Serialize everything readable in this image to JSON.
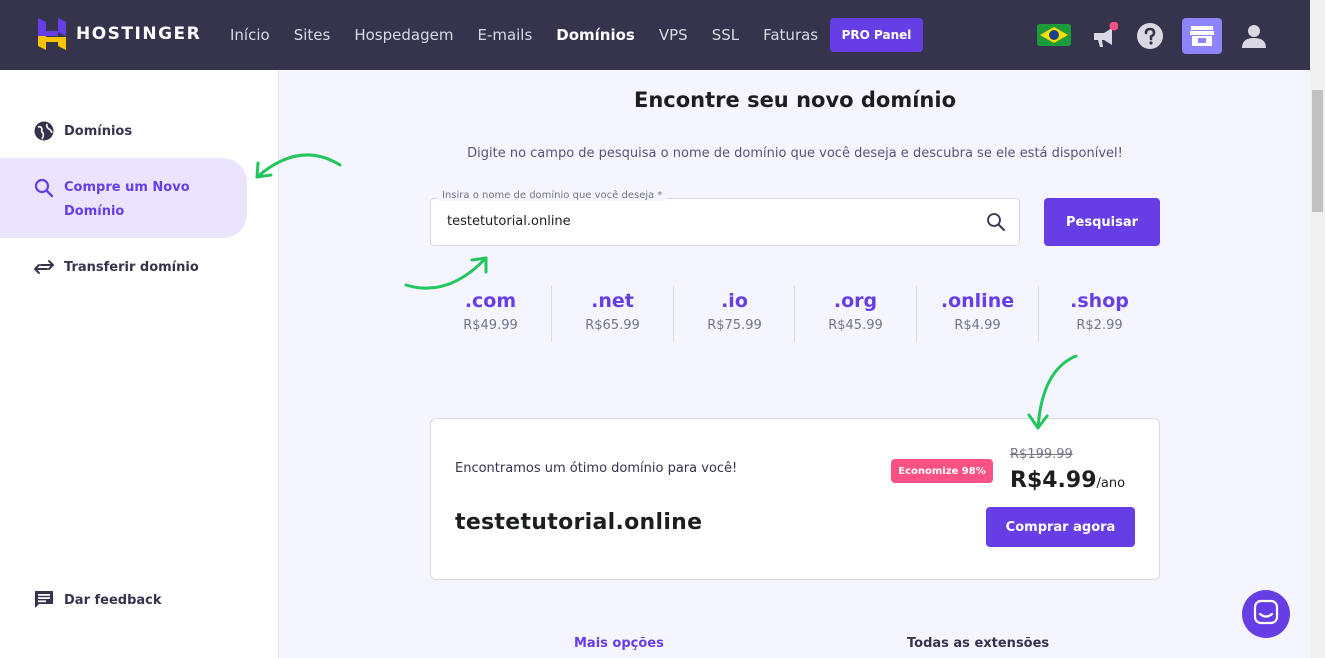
{
  "brand": {
    "name": "HOSTINGER"
  },
  "nav": {
    "items": [
      {
        "label": "Início",
        "active": false
      },
      {
        "label": "Sites",
        "active": false
      },
      {
        "label": "Hospedagem",
        "active": false
      },
      {
        "label": "E-mails",
        "active": false
      },
      {
        "label": "Domínios",
        "active": true
      },
      {
        "label": "VPS",
        "active": false
      },
      {
        "label": "SSL",
        "active": false
      },
      {
        "label": "Faturas",
        "active": false
      }
    ],
    "pro_panel": "PRO Panel",
    "icons": [
      "brazil-flag-icon",
      "megaphone-icon",
      "help-icon",
      "store-icon",
      "user-icon"
    ]
  },
  "sidebar": {
    "items": [
      {
        "label": "Domínios",
        "icon": "globe-icon"
      },
      {
        "label": "Compre um Novo Domínio",
        "icon": "search-icon",
        "active": true
      },
      {
        "label": "Transferir domínio",
        "icon": "transfer-icon"
      }
    ],
    "feedback": "Dar feedback"
  },
  "main": {
    "title": "Encontre seu novo domínio",
    "subtitle": "Digite no campo de pesquisa o nome de domínio que você deseja e descubra se ele está disponível!",
    "search": {
      "legend": "Insira o nome de domínio que você deseja *",
      "value": "testetutorial.online",
      "button": "Pesquisar"
    },
    "tlds": [
      {
        "ext": ".com",
        "price": "R$49.99"
      },
      {
        "ext": ".net",
        "price": "R$65.99"
      },
      {
        "ext": ".io",
        "price": "R$75.99"
      },
      {
        "ext": ".org",
        "price": "R$45.99"
      },
      {
        "ext": ".online",
        "price": "R$4.99"
      },
      {
        "ext": ".shop",
        "price": "R$2.99"
      }
    ],
    "result": {
      "found_text": "Encontramos um ótimo domínio para você!",
      "domain": "testetutorial.online",
      "badge": "Economize 98%",
      "old_price": "R$199.99",
      "price": "R$4.99",
      "period": "/ano",
      "buy_button": "Comprar agora"
    },
    "bottom_links": [
      "Mais opções",
      "Todas as extensões"
    ]
  },
  "colors": {
    "nav_bg": "#36344d",
    "accent": "#673de6",
    "badge": "#fc5185",
    "annotation": "#22c55e"
  }
}
